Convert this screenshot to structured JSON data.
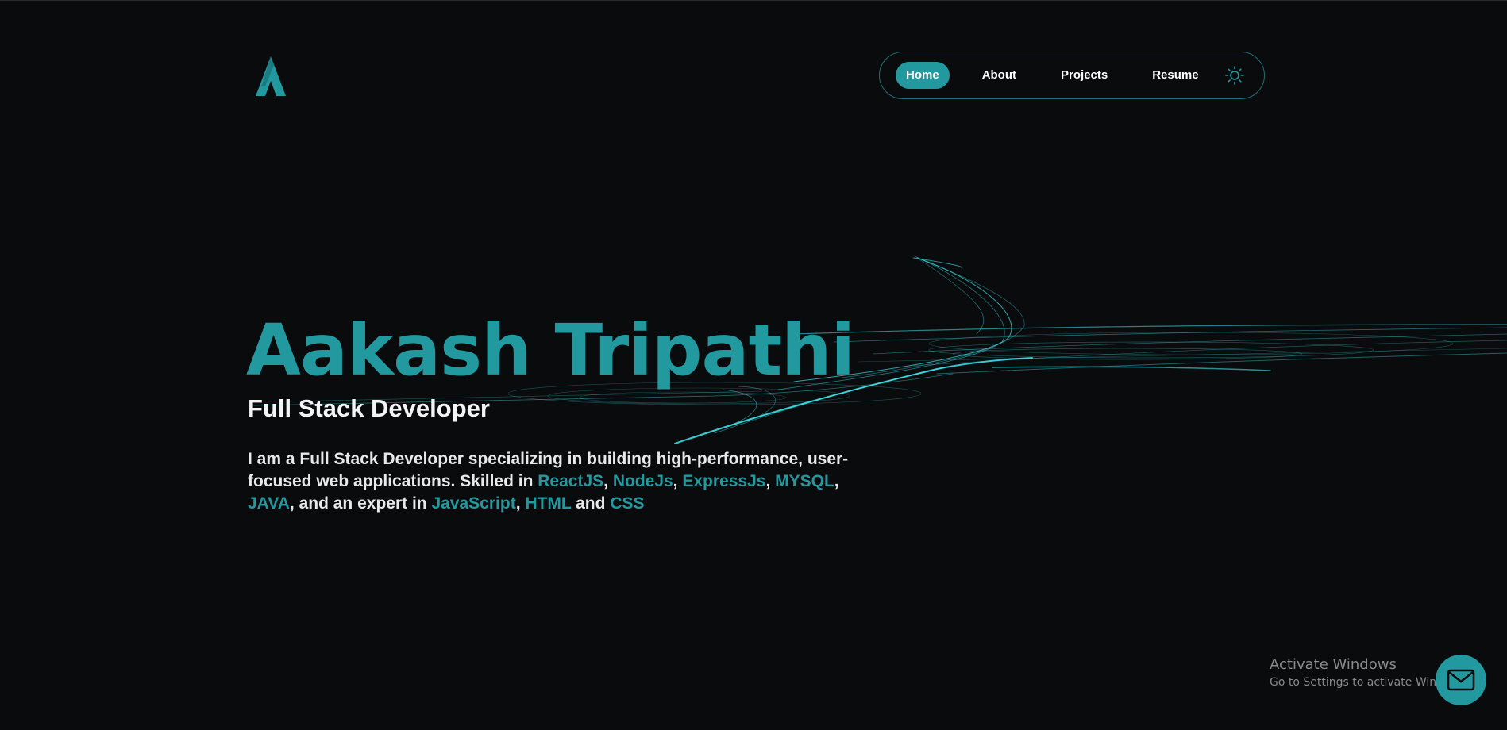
{
  "header": {
    "logo_name": "logo-a-icon",
    "nav": {
      "items": [
        {
          "label": "Home",
          "active": true
        },
        {
          "label": "About",
          "active": false
        },
        {
          "label": "Projects",
          "active": false
        },
        {
          "label": "Resume",
          "active": false
        }
      ],
      "theme_toggle_icon": "sun-icon"
    }
  },
  "hero": {
    "name": "Aakash Tripathi",
    "role": "Full Stack Developer",
    "desc": {
      "intro": "I am a Full Stack Developer specializing in building high-performance, user-focused web applications. Skilled in ",
      "skill_1": "ReactJS",
      "sep_1": ", ",
      "skill_2": "NodeJs",
      "sep_2": ", ",
      "skill_3": "ExpressJs",
      "sep_3": ", ",
      "skill_4": "MYSQL",
      "sep_4": ", ",
      "skill_5": "JAVA",
      "mid": ", and an expert in ",
      "skill_6": "JavaScript",
      "sep_6": ", ",
      "skill_7": "HTML",
      "and": " and ",
      "skill_8": "CSS"
    }
  },
  "watermark": {
    "title": "Activate Windows",
    "subtitle": "Go to Settings to activate Windows."
  },
  "contact": {
    "icon": "mail-icon"
  },
  "colors": {
    "background": "#0a0b0d",
    "accent": "#22999f",
    "swirl": "#3ee6ee",
    "text": "#ffffff"
  }
}
